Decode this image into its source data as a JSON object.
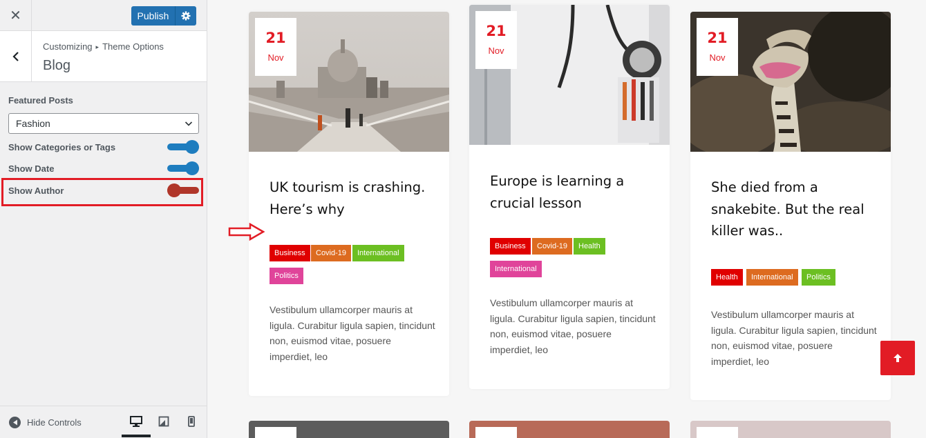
{
  "topbar": {
    "close_glyph": "✕",
    "publish_label": "Publish"
  },
  "section": {
    "breadcrumb_root": "Customizing",
    "breadcrumb_sep": "▸",
    "breadcrumb_parent": "Theme Options",
    "title": "Blog"
  },
  "controls": {
    "featured_label": "Featured Posts",
    "featured_value": "Fashion",
    "show_categories_label": "Show Categories or Tags",
    "show_categories": true,
    "show_date_label": "Show Date",
    "show_date": true,
    "show_author_label": "Show Author",
    "show_author": false
  },
  "bottombar": {
    "hide_controls_label": "Hide Controls"
  },
  "posts": [
    {
      "day": "21",
      "month": "Nov",
      "title": "UK tourism is crashing. Here’s why",
      "tags": [
        "Business",
        "Covid-19",
        "International",
        "Politics"
      ],
      "excerpt": "Vestibulum ullamcorper mauris at ligula. Curabitur ligula sapien, tincidunt non, euismod vitae, posuere imperdiet, leo"
    },
    {
      "day": "21",
      "month": "Nov",
      "title": "Europe is learning a crucial lesson",
      "tags": [
        "Business",
        "Covid-19",
        "Health",
        "International"
      ],
      "excerpt": "Vestibulum ullamcorper mauris at ligula. Curabitur ligula sapien, tincidunt non, euismod vitae, posuere imperdiet, leo"
    },
    {
      "day": "21",
      "month": "Nov",
      "title": "She died from a snakebite. But the real killer was..",
      "tags": [
        "Health",
        "International",
        "Politics"
      ],
      "excerpt": "Vestibulum ullamcorper mauris at ligula. Curabitur ligula sapien, tincidunt non, euismod vitae, posuere imperdiet, leo"
    }
  ],
  "colors": {
    "accent": "#e21c25",
    "wp_blue": "#2271b1",
    "toggle_on": "#1e7dbf",
    "toggle_off": "#b0362a",
    "tag_business": "#e00000",
    "tag_covid": "#dd6b20",
    "tag_international": "#6cbf22",
    "tag_health": "#6cbf22",
    "tag_politics": "#e0449a"
  }
}
